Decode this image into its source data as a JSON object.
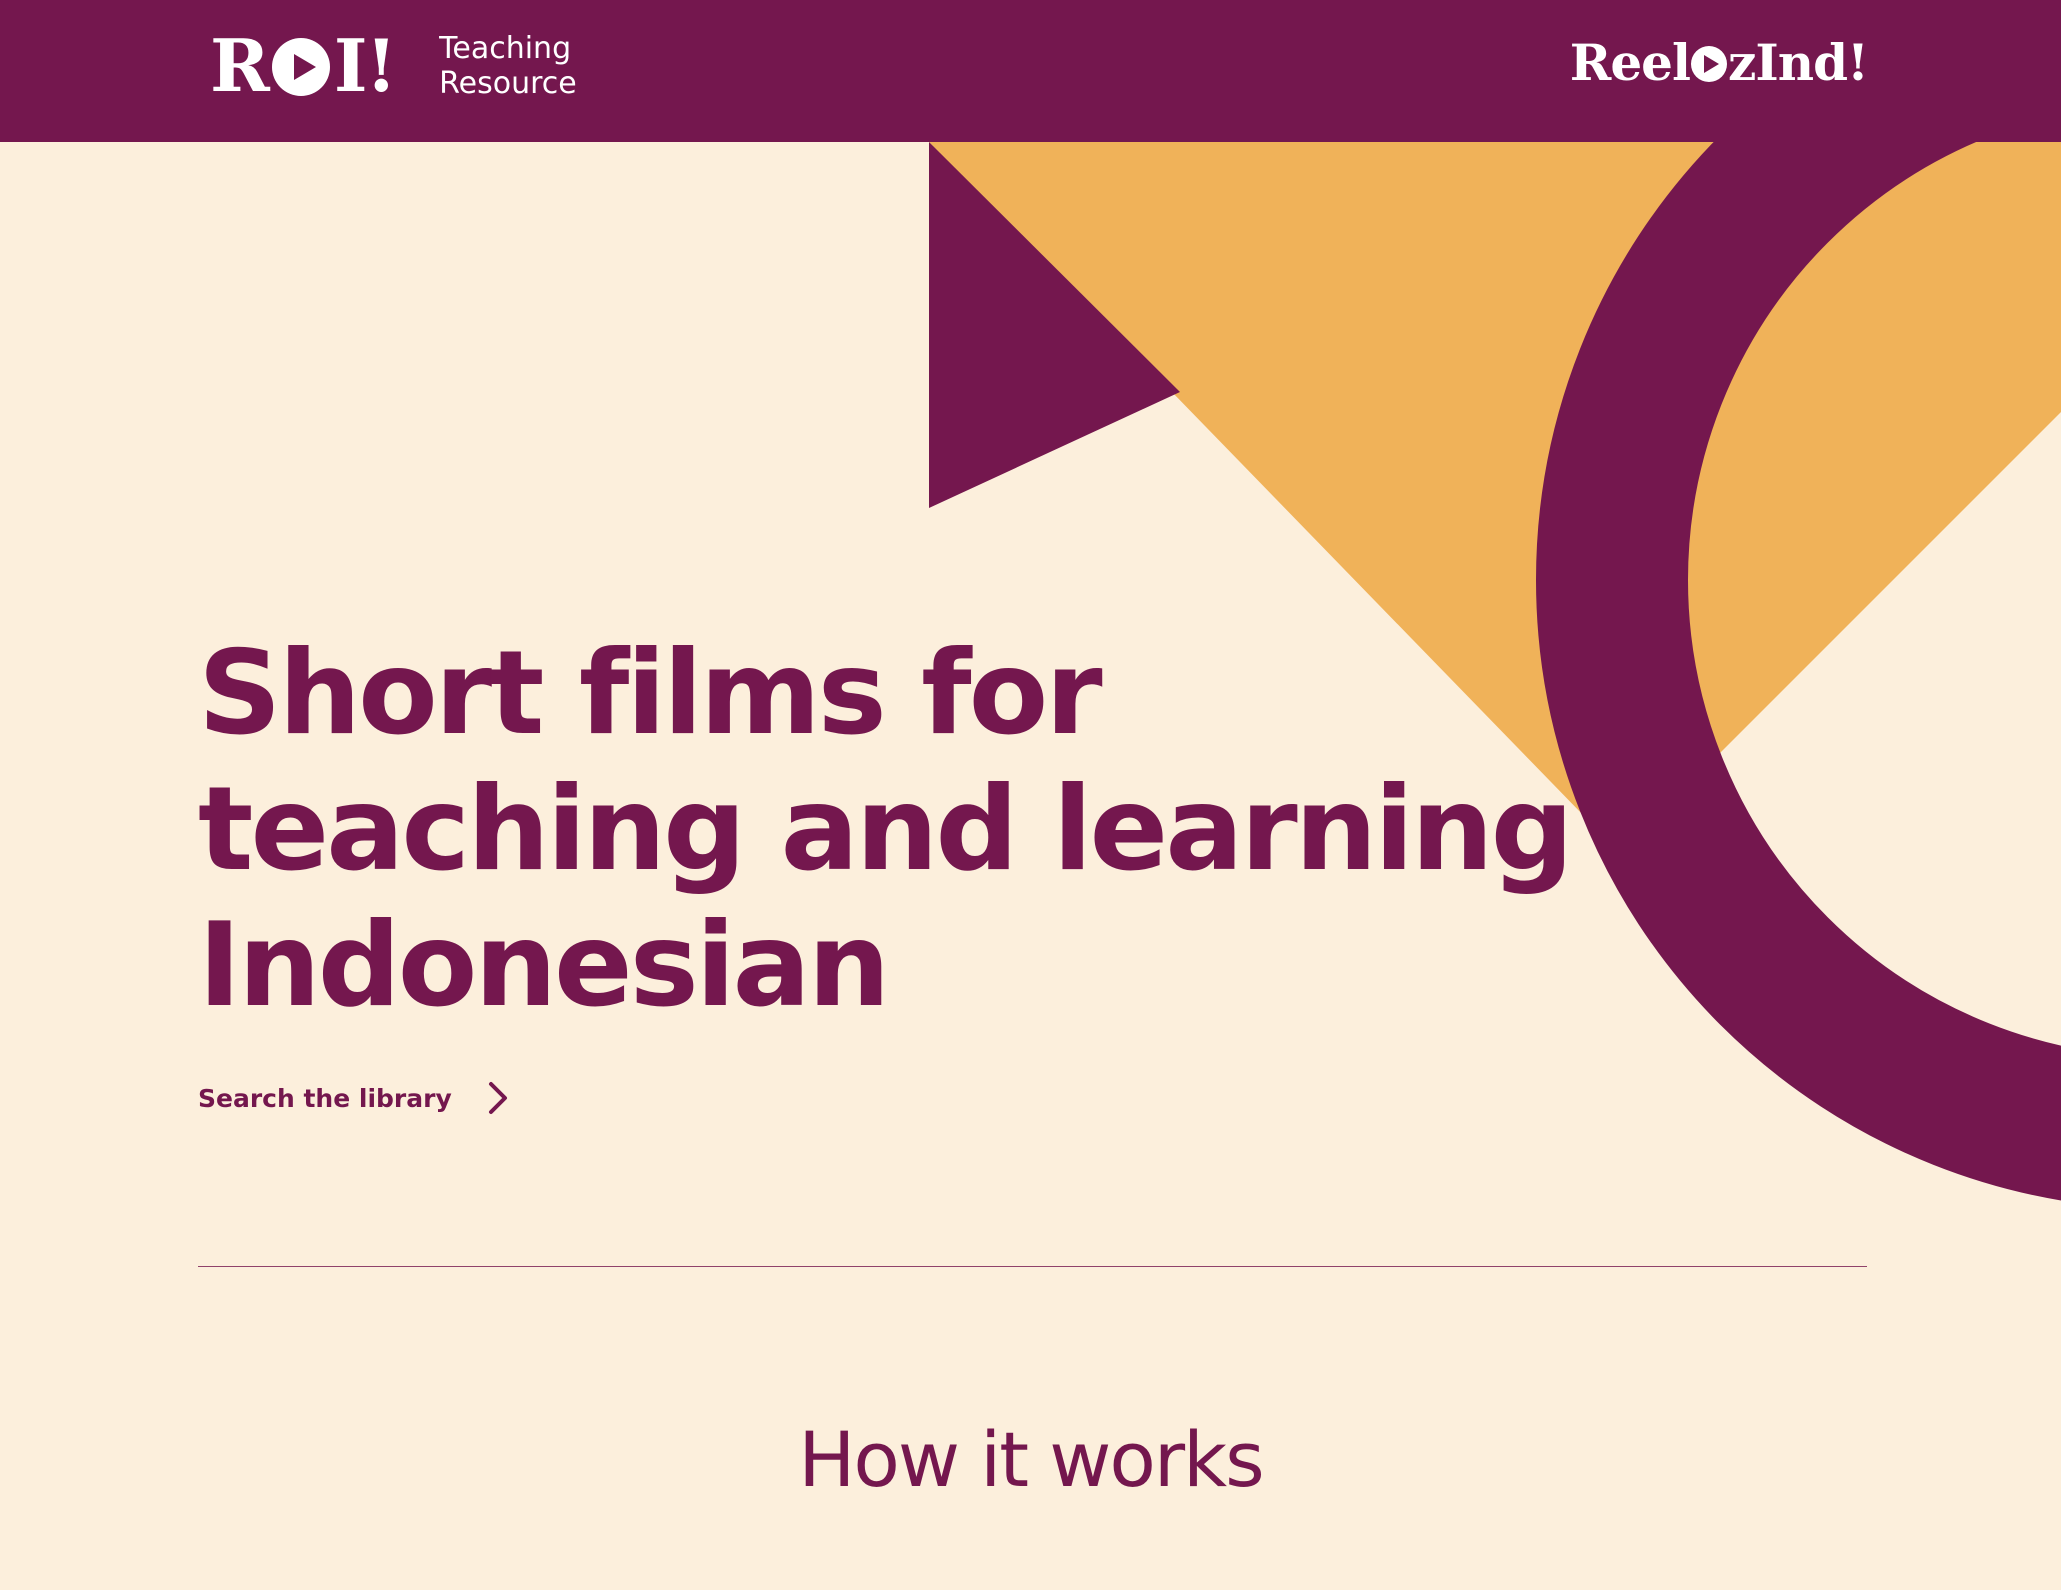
{
  "header": {
    "brand_mark": "ROI!",
    "brand_sub_line1": "Teaching",
    "brand_sub_line2": "Resource",
    "partner_logo_prefix": "Reel",
    "partner_logo_suffix": "zInd!"
  },
  "hero": {
    "title_line1": "Short films for",
    "title_line2": "teaching and learning",
    "title_line3": "Indonesian",
    "cta_label": "Search the library"
  },
  "section": {
    "how_title": "How it works"
  },
  "colors": {
    "brand_purple": "#74174e",
    "accent_orange": "#f0b259",
    "background_cream": "#fcefdc"
  },
  "icons": {
    "logo_play": "play-circle-icon",
    "cta_arrow": "chevron-right-icon"
  }
}
